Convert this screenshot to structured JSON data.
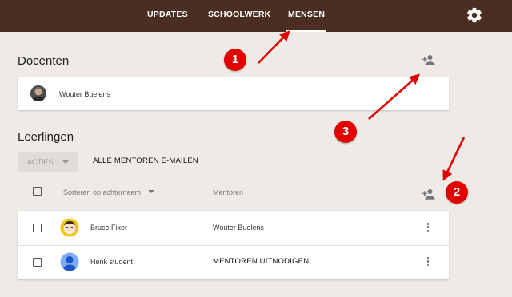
{
  "nav": {
    "tabs": [
      {
        "label": "UPDATES"
      },
      {
        "label": "SCHOOLWERK"
      },
      {
        "label": "MENSEN",
        "active": true
      }
    ],
    "settings_icon": "gear-icon"
  },
  "teachers": {
    "title": "Docenten",
    "add_icon": "person-add-icon",
    "items": [
      {
        "name": "Wouter Buelens",
        "avatar": "photo"
      }
    ]
  },
  "students": {
    "title": "Leerlingen",
    "actions_label": "ACTIES",
    "email_all_label": "ALLE MENTOREN E-MAILEN",
    "sort_label": "Sorteren op achternaam",
    "mentors_header": "Mentoren",
    "add_icon": "person-add-icon",
    "rows": [
      {
        "name": "Bruce Fixer",
        "mentor": "Wouter Buelens",
        "avatar": "cartoon"
      },
      {
        "name": "Henk student",
        "mentor": "MENTOREN UITNODIGEN",
        "avatar": "default"
      }
    ]
  },
  "annotations": {
    "markers": [
      "1",
      "2",
      "3"
    ],
    "color": "#e00000"
  },
  "colors": {
    "topbar": "#4a2e22",
    "background": "#eeebe7",
    "card": "#ffffff"
  }
}
